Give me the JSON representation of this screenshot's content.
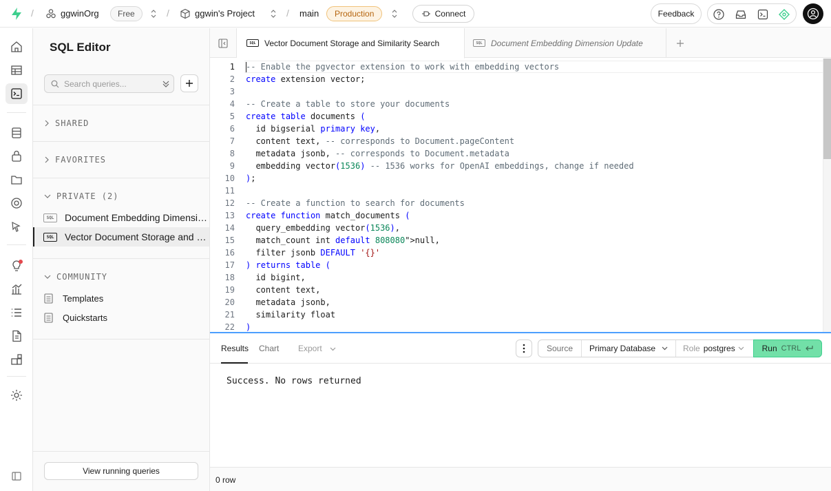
{
  "topbar": {
    "org_name": "ggwinOrg",
    "org_plan": "Free",
    "project_name": "ggwin's Project",
    "branch_name": "main",
    "environment": "Production",
    "connect_label": "Connect",
    "feedback_label": "Feedback",
    "brand_color": "#3ecf8e",
    "icons": [
      "help-icon",
      "inbox-icon",
      "terminal-icon",
      "advisor-icon"
    ]
  },
  "rail": {
    "icons": [
      "home-icon",
      "table-editor-icon",
      "sql-editor-icon",
      "database-icon",
      "auth-icon",
      "storage-icon",
      "realtime-icon",
      "edge-functions-icon",
      "advisors-icon",
      "reports-icon",
      "logs-icon",
      "api-docs-icon",
      "integrations-icon",
      "settings-icon",
      "collapse-icon"
    ]
  },
  "sidebar": {
    "title": "SQL Editor",
    "search_placeholder": "Search queries...",
    "sections": {
      "shared": "SHARED",
      "favorites": "FAVORITES",
      "private": "PRIVATE (2)",
      "community": "COMMUNITY"
    },
    "private_items": [
      {
        "label": "Document Embedding Dimension Update",
        "badge": "SQL"
      },
      {
        "label": "Vector Document Storage and Similarity Search",
        "badge": "SQL"
      }
    ],
    "community_items": [
      {
        "label": "Templates"
      },
      {
        "label": "Quickstarts"
      }
    ],
    "view_running_label": "View running queries"
  },
  "tabs": [
    {
      "label": "Vector Document Storage and Similarity Search",
      "badge": "SQL",
      "active": true
    },
    {
      "label": "Document Embedding Dimension Update",
      "badge": "SQL",
      "active": false
    }
  ],
  "editor": {
    "lines": [
      "-- Enable the pgvector extension to work with embedding vectors",
      "create extension vector;",
      "",
      "-- Create a table to store your documents",
      "create table documents (",
      "  id bigserial primary key,",
      "  content text, -- corresponds to Document.pageContent",
      "  metadata jsonb, -- corresponds to Document.metadata",
      "  embedding vector(1536) -- 1536 works for OpenAI embeddings, change if needed",
      ");",
      "",
      "-- Create a function to search for documents",
      "create function match_documents (",
      "  query_embedding vector(1536),",
      "  match_count int default null,",
      "  filter jsonb DEFAULT '{}'",
      ") returns table (",
      "  id bigint,",
      "  content text,",
      "  metadata jsonb,",
      "  similarity float",
      ")"
    ]
  },
  "results": {
    "tabs": [
      "Results",
      "Chart"
    ],
    "export_label": "Export",
    "source_label": "Source",
    "source_value": "Primary Database",
    "role_label": "Role",
    "role_value": "postgres",
    "run_label": "Run",
    "run_shortcut": "CTRL",
    "message": "Success. No rows returned",
    "row_count": "0 row",
    "run_color": "#72e0a8"
  }
}
